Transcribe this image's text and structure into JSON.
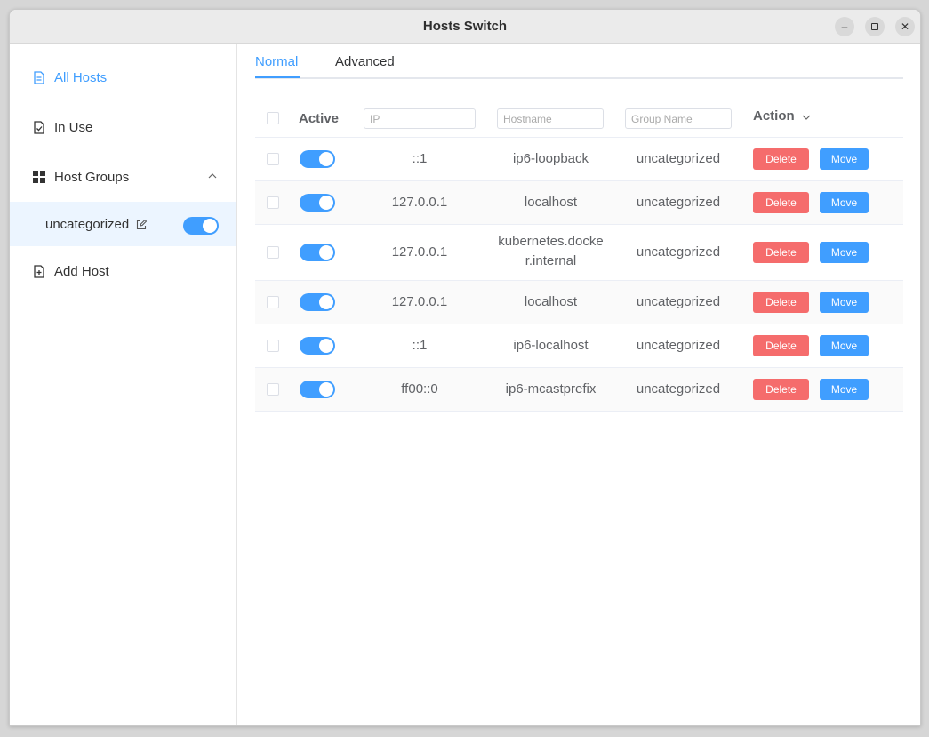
{
  "window": {
    "title": "Hosts Switch",
    "controls": {
      "minimize": "–",
      "maximize": "□",
      "close": "✕"
    }
  },
  "sidebar": {
    "all_hosts": "All Hosts",
    "in_use": "In Use",
    "host_groups": "Host Groups",
    "group_name": "uncategorized",
    "add_host": "Add Host"
  },
  "tabs": {
    "normal": "Normal",
    "advanced": "Advanced"
  },
  "table": {
    "headers": {
      "active": "Active",
      "action": "Action"
    },
    "placeholders": {
      "ip": "IP",
      "hostname": "Hostname",
      "group": "Group Name"
    },
    "delete_label": "Delete",
    "move_label": "Move",
    "rows": [
      {
        "ip": "::1",
        "hostname": "ip6-loopback",
        "group": "uncategorized"
      },
      {
        "ip": "127.0.0.1",
        "hostname": "localhost",
        "group": "uncategorized"
      },
      {
        "ip": "127.0.0.1",
        "hostname_l1": "kubernetes.docke",
        "hostname_l2": "r.internal",
        "group": "uncategorized"
      },
      {
        "ip": "127.0.0.1",
        "hostname": "localhost",
        "group": "uncategorized"
      },
      {
        "ip": "::1",
        "hostname": "ip6-localhost",
        "group": "uncategorized"
      },
      {
        "ip": "ff00::0",
        "hostname": "ip6-mcastprefix",
        "group": "uncategorized"
      }
    ]
  },
  "colors": {
    "accent": "#409eff",
    "danger": "#f56c6c"
  }
}
